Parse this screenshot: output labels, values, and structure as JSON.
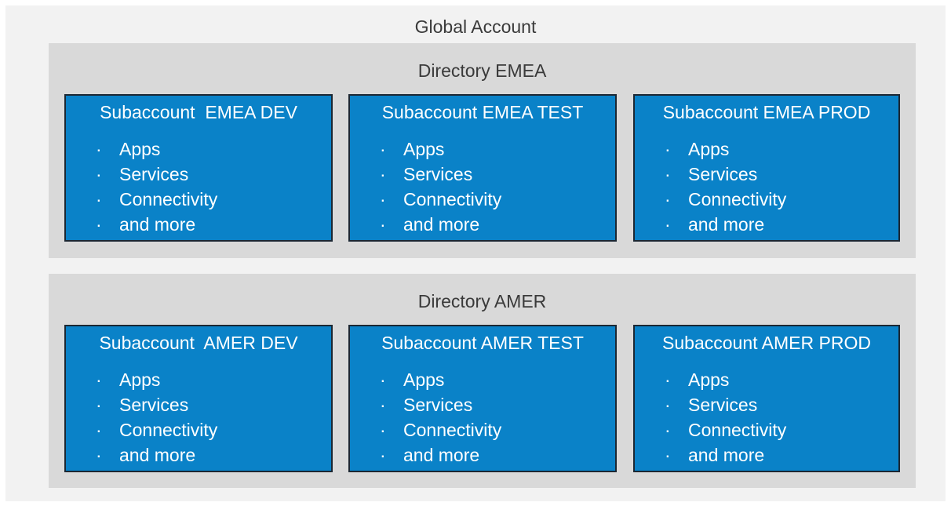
{
  "global_account": {
    "title": "Global Account",
    "directories": [
      {
        "title": "Directory EMEA",
        "subaccounts": [
          {
            "title": "Subaccount  EMEA DEV",
            "items": [
              "Apps",
              "Services",
              "Connectivity",
              "and more"
            ]
          },
          {
            "title": "Subaccount EMEA TEST",
            "items": [
              "Apps",
              "Services",
              "Connectivity",
              "and more"
            ]
          },
          {
            "title": "Subaccount EMEA PROD",
            "items": [
              "Apps",
              "Services",
              "Connectivity",
              "and more"
            ]
          }
        ]
      },
      {
        "title": "Directory AMER",
        "subaccounts": [
          {
            "title": "Subaccount  AMER DEV",
            "items": [
              "Apps",
              "Services",
              "Connectivity",
              "and more"
            ]
          },
          {
            "title": "Subaccount AMER TEST",
            "items": [
              "Apps",
              "Services",
              "Connectivity",
              "and more"
            ]
          },
          {
            "title": "Subaccount AMER PROD",
            "items": [
              "Apps",
              "Services",
              "Connectivity",
              "and more"
            ]
          }
        ]
      }
    ]
  },
  "colors": {
    "outer_background": "#f2f2f2",
    "directory_background": "#d9d9d9",
    "subaccount_fill": "#0a82c8",
    "subaccount_border": "#1b2733",
    "subaccount_text": "#ffffff",
    "heading_text": "#3a3a3a"
  }
}
